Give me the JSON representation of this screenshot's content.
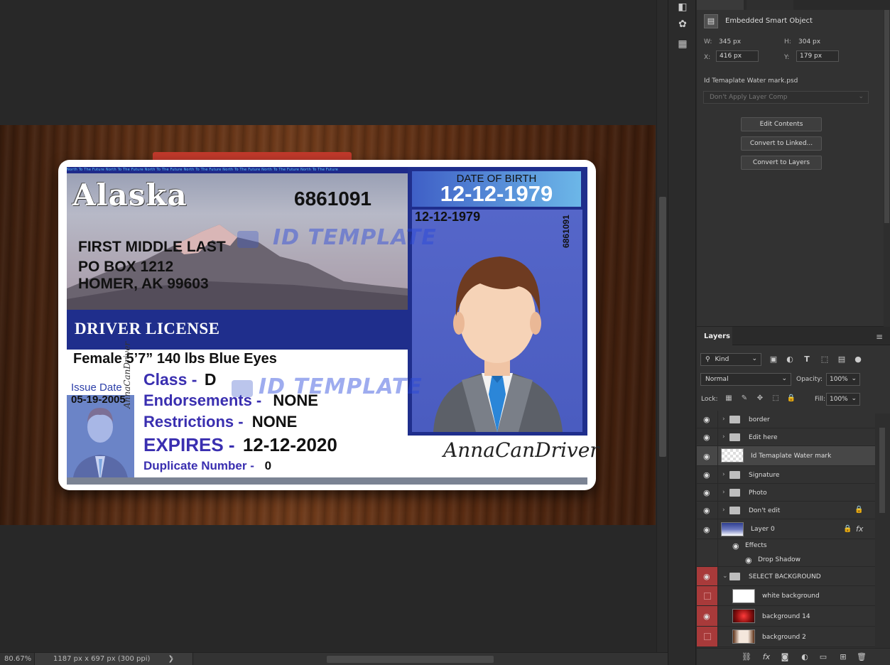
{
  "canvas": {
    "card": {
      "microtext": "North To The Future North To The Future North To The Future North To The Future North To The Future North To The Future North To The Future",
      "state": "Alaska",
      "license_number": "6861091",
      "name_line": "FIRST MIDDLE LAST",
      "addr_line1": "PO BOX 1212",
      "addr_line2": "HOMER, AK 99603",
      "doc_type": "DRIVER LICENSE",
      "description": "Female  5’7” 140 lbs  Blue Eyes",
      "issue_label": "Issue Date",
      "issue_date": "05-19-2005",
      "class_label": "Class -",
      "class_value": "D",
      "endorsements_label": "Endorsements -",
      "endorsements_value": "NONE",
      "restrictions_label": "Restrictions -",
      "restrictions_value": "NONE",
      "expires_label": "EXPIRES -",
      "expires_value": "12-12-2020",
      "duplicate_label": "Duplicate Number -",
      "duplicate_value": "0",
      "dob_label": "DATE OF BIRTH",
      "dob_value": "12-12-1979",
      "photo_dob": "12-12-1979",
      "photo_number": "6861091",
      "watermark": "ID TEMPLATE",
      "signature": "AnnaCanDriver"
    },
    "colors": {
      "card_blue": "#1f2e8c",
      "field_purple": "#3a2fb0",
      "watermark_blue": "#2846dc"
    }
  },
  "status_bar": {
    "zoom": "80.67%",
    "dimensions": "1187 px x 697 px (300 ppi)",
    "arrow": "❯"
  },
  "properties": {
    "type_label": "Embedded Smart Object",
    "w_label": "W:",
    "w_value": "345 px",
    "h_label": "H:",
    "h_value": "304 px",
    "x_label": "X:",
    "x_value": "416 px",
    "y_label": "Y:",
    "y_value": "179 px",
    "file_name": "Id Temaplate Water mark.psd",
    "layer_comp": "Don't Apply Layer Comp",
    "buttons": {
      "edit_contents": "Edit Contents",
      "convert_linked": "Convert to Linked...",
      "convert_layers": "Convert to Layers"
    }
  },
  "layers": {
    "tab_label": "Layers",
    "kind_label": "Kind",
    "blend_mode": "Normal",
    "opacity_label": "Opacity:",
    "opacity_value": "100%",
    "lock_label": "Lock:",
    "fill_label": "Fill:",
    "fill_value": "100%",
    "rows": {
      "border": "border",
      "edit_here": "Edit here",
      "watermark": "Id Temaplate Water mark",
      "signature": "Signature",
      "photo": "Photo",
      "dont_edit": "Don't edit",
      "layer0": "Layer 0",
      "effects": "Effects",
      "drop_shadow": "Drop Shadow",
      "select_bg": "SELECT BACKGROUND",
      "white_bg": "white background",
      "bg14": "background 14",
      "bg2": "background 2"
    },
    "icons": [
      "eye-icon",
      "folder-icon",
      "lock-icon",
      "fx-icon",
      "link-icon",
      "mask-icon",
      "adjustment-icon",
      "new-group-icon",
      "new-layer-icon",
      "trash-icon"
    ]
  }
}
